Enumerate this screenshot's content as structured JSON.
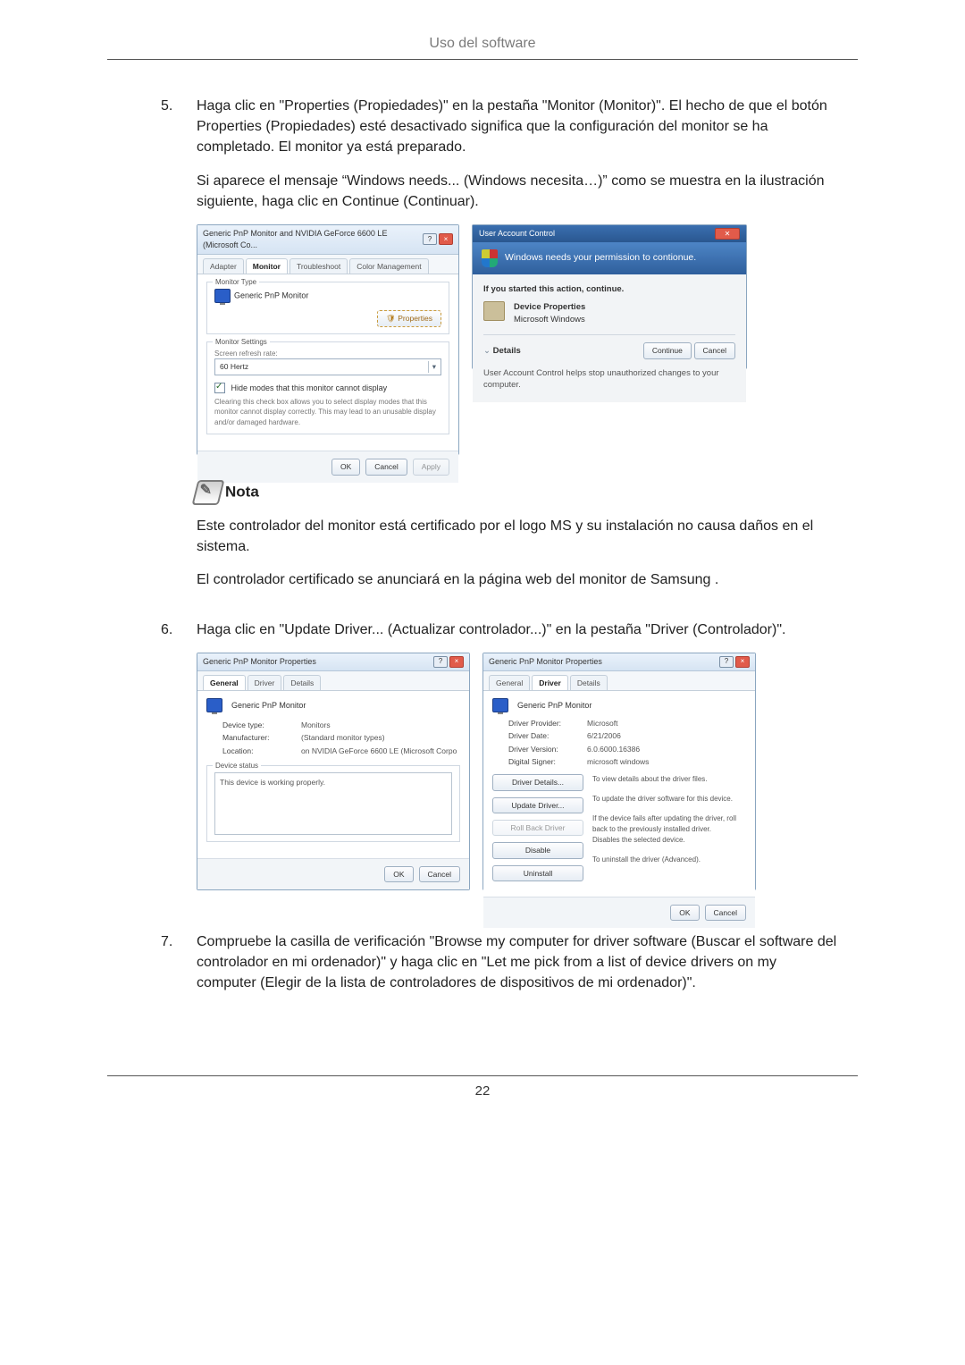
{
  "page": {
    "header": "Uso del software",
    "number": "22"
  },
  "step5": {
    "num": "5.",
    "para1": "Haga clic en \"Properties (Propiedades)\" en la pestaña \"Monitor (Monitor)\". El hecho de que el botón Properties (Propiedades) esté desactivado significa que la configuración del monitor se ha completado. El monitor ya está preparado.",
    "para2": "Si aparece el mensaje “Windows needs... (Windows necesita…)” como se muestra en la ilustración siguiente, haga clic en Continue (Continuar)."
  },
  "note": {
    "label": "Nota",
    "p1": "Este controlador del monitor está certificado por el logo MS y su instalación no causa daños en el sistema.",
    "p2": "El controlador certificado se anunciará en la página web del monitor de Samsung ."
  },
  "step6": {
    "num": "6.",
    "para": "Haga clic en \"Update Driver... (Actualizar controlador...)\" en la pestaña \"Driver (Controlador)\"."
  },
  "step7": {
    "num": "7.",
    "para": "Compruebe la casilla de verificación \"Browse my computer for driver software (Buscar el software del controlador en mi ordenador)\" y haga clic en \"Let me pick from a list of device drivers on my computer (Elegir de la lista de controladores de dispositivos de mi ordenador)\"."
  },
  "fig1": {
    "left": {
      "title": "Generic PnP Monitor and NVIDIA GeForce 6600 LE (Microsoft Co...",
      "tabs": {
        "adapter": "Adapter",
        "monitor": "Monitor",
        "troubleshoot": "Troubleshoot",
        "color": "Color Management"
      },
      "monitorTypeLegend": "Monitor Type",
      "monitorName": "Generic PnP Monitor",
      "propertiesBtn": "Properties",
      "settingsLegend": "Monitor Settings",
      "refreshLabel": "Screen refresh rate:",
      "refreshValue": "60 Hertz",
      "hideModes": "Hide modes that this monitor cannot display",
      "hideDesc": "Clearing this check box allows you to select display modes that this monitor cannot display correctly. This may lead to an unusable display and/or damaged hardware.",
      "ok": "OK",
      "cancel": "Cancel",
      "apply": "Apply"
    },
    "right": {
      "title": "User Account Control",
      "banner": "Windows needs your permission to contionue.",
      "ifStarted": "If you started this action, continue.",
      "devProps": "Device Properties",
      "msWin": "Microsoft Windows",
      "details": "Details",
      "continue": "Continue",
      "cancel": "Cancel",
      "helpLine": "User Account Control helps stop unauthorized changes to your computer."
    }
  },
  "fig2": {
    "title": "Generic PnP Monitor Properties",
    "tabs": {
      "general": "General",
      "driver": "Driver",
      "details": "Details"
    },
    "monitorName": "Generic PnP Monitor",
    "left": {
      "k_deviceType": "Device type:",
      "v_deviceType": "Monitors",
      "k_manu": "Manufacturer:",
      "v_manu": "(Standard monitor types)",
      "k_loc": "Location:",
      "v_loc": "on NVIDIA GeForce 6600 LE (Microsoft Corpo",
      "statusLegend": "Device status",
      "statusText": "This device is working properly."
    },
    "right": {
      "k_provider": "Driver Provider:",
      "v_provider": "Microsoft",
      "k_date": "Driver Date:",
      "v_date": "6/21/2006",
      "k_version": "Driver Version:",
      "v_version": "6.0.6000.16386",
      "k_signer": "Digital Signer:",
      "v_signer": "microsoft windows",
      "btn_details": "Driver Details...",
      "txt_details": "To view details about the driver files.",
      "btn_update": "Update Driver...",
      "txt_update": "To update the driver software for this device.",
      "btn_rollback": "Roll Back Driver",
      "txt_rollback": "If the device fails after updating the driver, roll back to the previously installed driver.",
      "btn_disable": "Disable",
      "txt_disable": "Disables the selected device.",
      "btn_uninstall": "Uninstall",
      "txt_uninstall": "To uninstall the driver (Advanced)."
    },
    "ok": "OK",
    "cancel": "Cancel"
  }
}
